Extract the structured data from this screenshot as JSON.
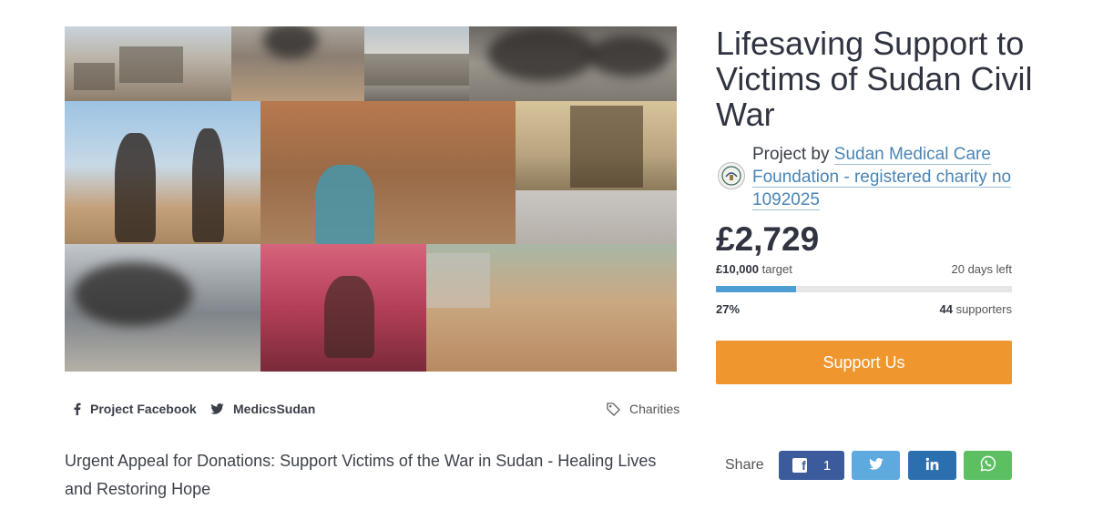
{
  "project": {
    "title": "Lifesaving Support to Victims of Sudan Civil War",
    "by_prefix": "Project by",
    "organisation": "Sudan Medical Care Foundation - registered charity no 1092025",
    "amount_raised": "£2,729",
    "target_amount": "£10,000",
    "target_label": "target",
    "days_left": "20 days left",
    "progress_percent_label": "27%",
    "progress_fraction": 0.27,
    "supporters_count": "44",
    "supporters_label": "supporters",
    "support_button_label": "Support Us",
    "description": "Urgent Appeal for Donations: Support Victims of the War in Sudan - Healing Lives and Restoring Hope"
  },
  "links": {
    "facebook_label": "Project Facebook",
    "twitter_label": "MedicsSudan",
    "category_label": "Charities"
  },
  "share": {
    "label": "Share",
    "facebook_count": "1",
    "buttons": [
      "facebook",
      "twitter",
      "linkedin",
      "whatsapp"
    ]
  },
  "icons": [
    "facebook-icon",
    "twitter-icon",
    "tag-icon",
    "linkedin-icon",
    "whatsapp-icon",
    "organisation-logo"
  ],
  "colors": {
    "accent_orange": "#f0962e",
    "progress_blue": "#4f9ed3",
    "facebook": "#3b5b9c",
    "twitter": "#5ea9dd",
    "linkedin": "#2c6fae",
    "whatsapp": "#5cbf62",
    "link_blue": "#4a85b5"
  }
}
